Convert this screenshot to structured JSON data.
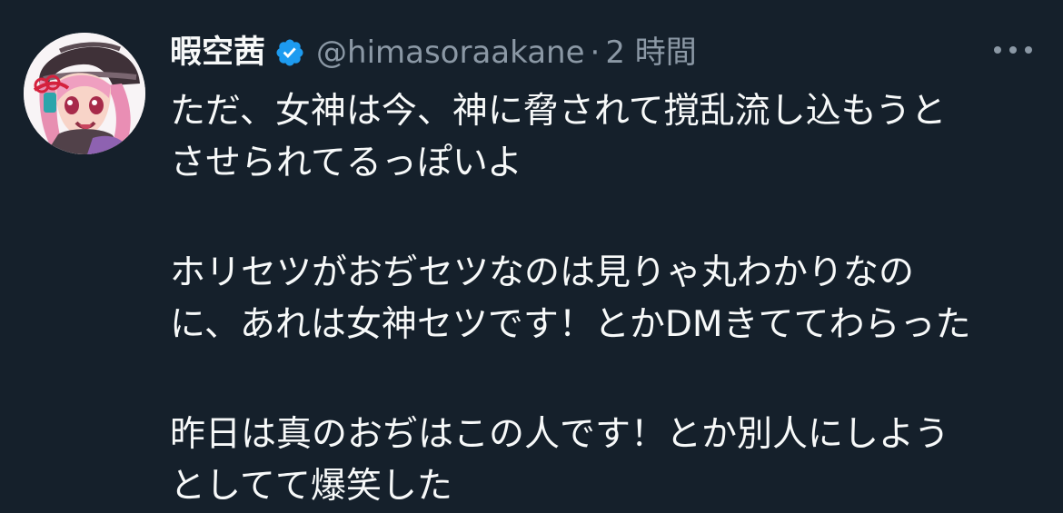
{
  "tweet": {
    "author": {
      "display_name": "暇空茜",
      "handle": "@himasoraakane",
      "verified": true,
      "avatar_icon": "profile-avatar-icon",
      "verified_icon": "verified-badge-icon"
    },
    "separator": "·",
    "time": "2 時間",
    "more_icon": "more-options-icon",
    "lines": [
      "ただ、女神は今、神に脅されて撹乱流し込もうと",
      "させられてるっぽいよ",
      "ホリセツがおぢセツなのは見りゃ丸わかりなの",
      "に、あれは女神セツです！とかDMきててわらった",
      "昨日は真のおぢはこの人です！とか別人にしよう",
      "としてて爆笑した"
    ]
  },
  "colors": {
    "background": "#15202b",
    "text": "#f7f9f9",
    "secondary": "#8b98a5",
    "verified": "#1d9bf0"
  }
}
